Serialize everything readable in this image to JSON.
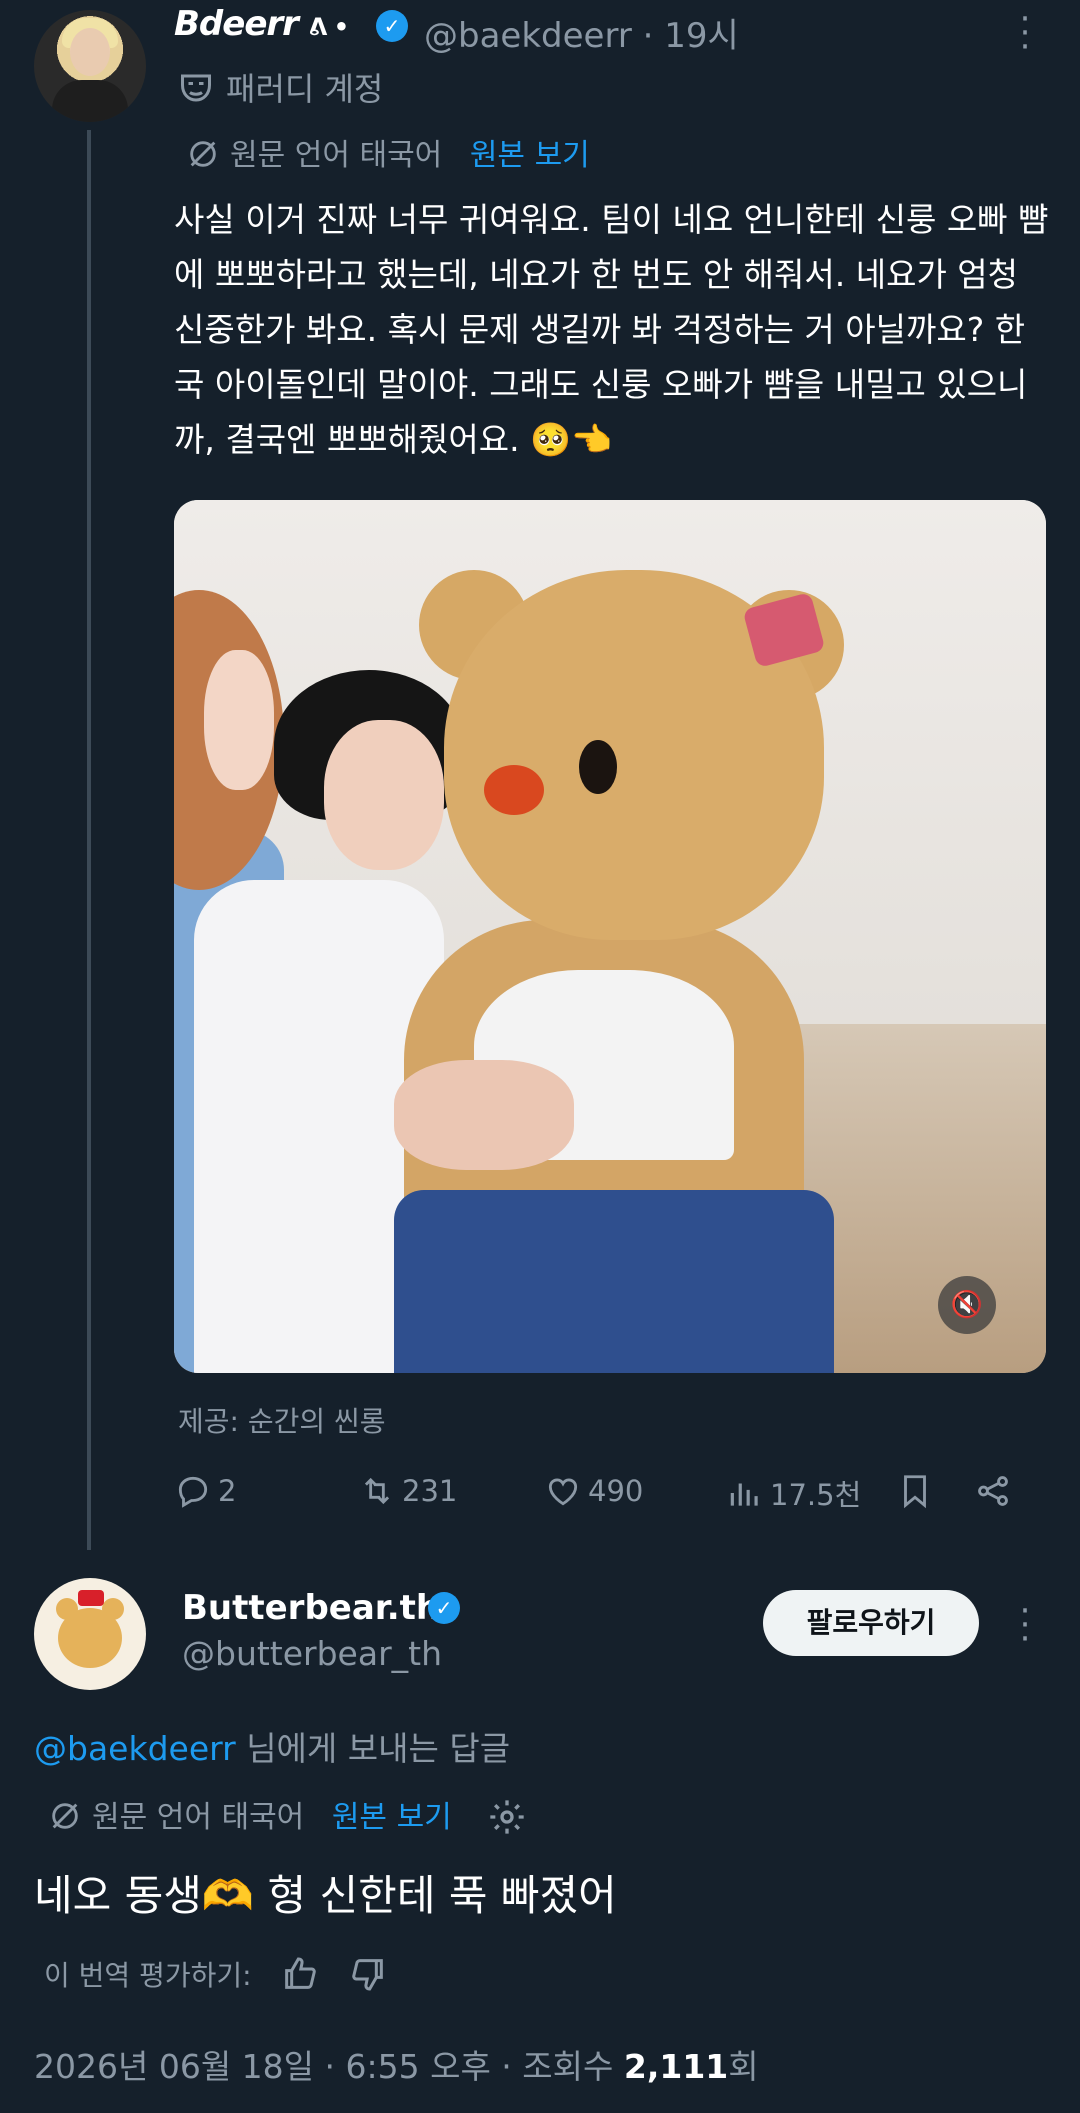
{
  "tweet": {
    "author_name": "Bdeerr",
    "author_emoji": "ᕕ •",
    "handle": "@baekdeerr",
    "time": "· 19시",
    "parody_label": "패러디 계정",
    "translate_label": "원문 언어 태국어",
    "show_original": "원본 보기",
    "body": "사실 이거 진짜 너무 귀여워요. 팀이 네요 언니한테 신룽 오빠 뺨에 뽀뽀하라고 했는데, 네요가 한 번도 안 해줘서. 네요가 엄청 신중한가 봐요. 혹시 문제 생길까 봐 걱정하는 거 아닐까요? 한국 아이돌인데 말이야. 그래도 신룽 오빠가 뺨을 내밀고 있으니까, 결국엔 뽀뽀해줬어요. 🥺👈",
    "media_source": "제공: 순간의 씬롱",
    "stats": {
      "replies": "2",
      "retweets": "231",
      "likes": "490",
      "views": "17.5천"
    }
  },
  "reply": {
    "author_name": "Butterbear.th",
    "handle": "@butterbear_th",
    "follow_label": "팔로우하기",
    "reply_to_handle": "@baekdeerr",
    "reply_to_suffix": " 님에게 보내는 답글",
    "translate_label": "원문 언어 태국어",
    "show_original": "원본 보기",
    "body": "네오 동생🫶 형 신한테 푹 빠졌어",
    "rate_label": "이 번역 평가하기:",
    "timestamp": "2026년 06월 18일 · 6:55 오후 · 조회수 ",
    "view_count": "2,111",
    "view_suffix": "회"
  },
  "colors": {
    "background": "#15202b",
    "accent": "#1d9bf0",
    "secondary_text": "#8b98a5"
  },
  "icons": [
    "parody-mask-icon",
    "translate-icon",
    "reply-icon",
    "retweet-icon",
    "like-icon",
    "views-icon",
    "bookmark-icon",
    "share-icon",
    "more-icon",
    "mute-icon",
    "gear-icon",
    "thumbs-up-icon",
    "thumbs-down-icon",
    "verified-icon"
  ]
}
